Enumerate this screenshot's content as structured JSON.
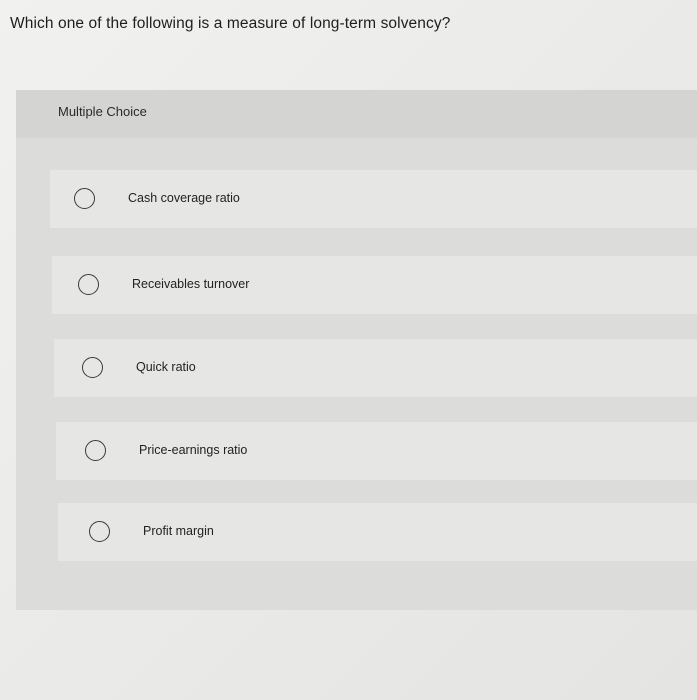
{
  "question": {
    "text": "Which one of the following is a measure of long-term solvency?"
  },
  "panel": {
    "title": "Multiple Choice"
  },
  "options": [
    {
      "label": "Cash coverage ratio"
    },
    {
      "label": "Receivables turnover"
    },
    {
      "label": "Quick ratio"
    },
    {
      "label": "Price-earnings ratio"
    },
    {
      "label": "Profit margin"
    }
  ]
}
